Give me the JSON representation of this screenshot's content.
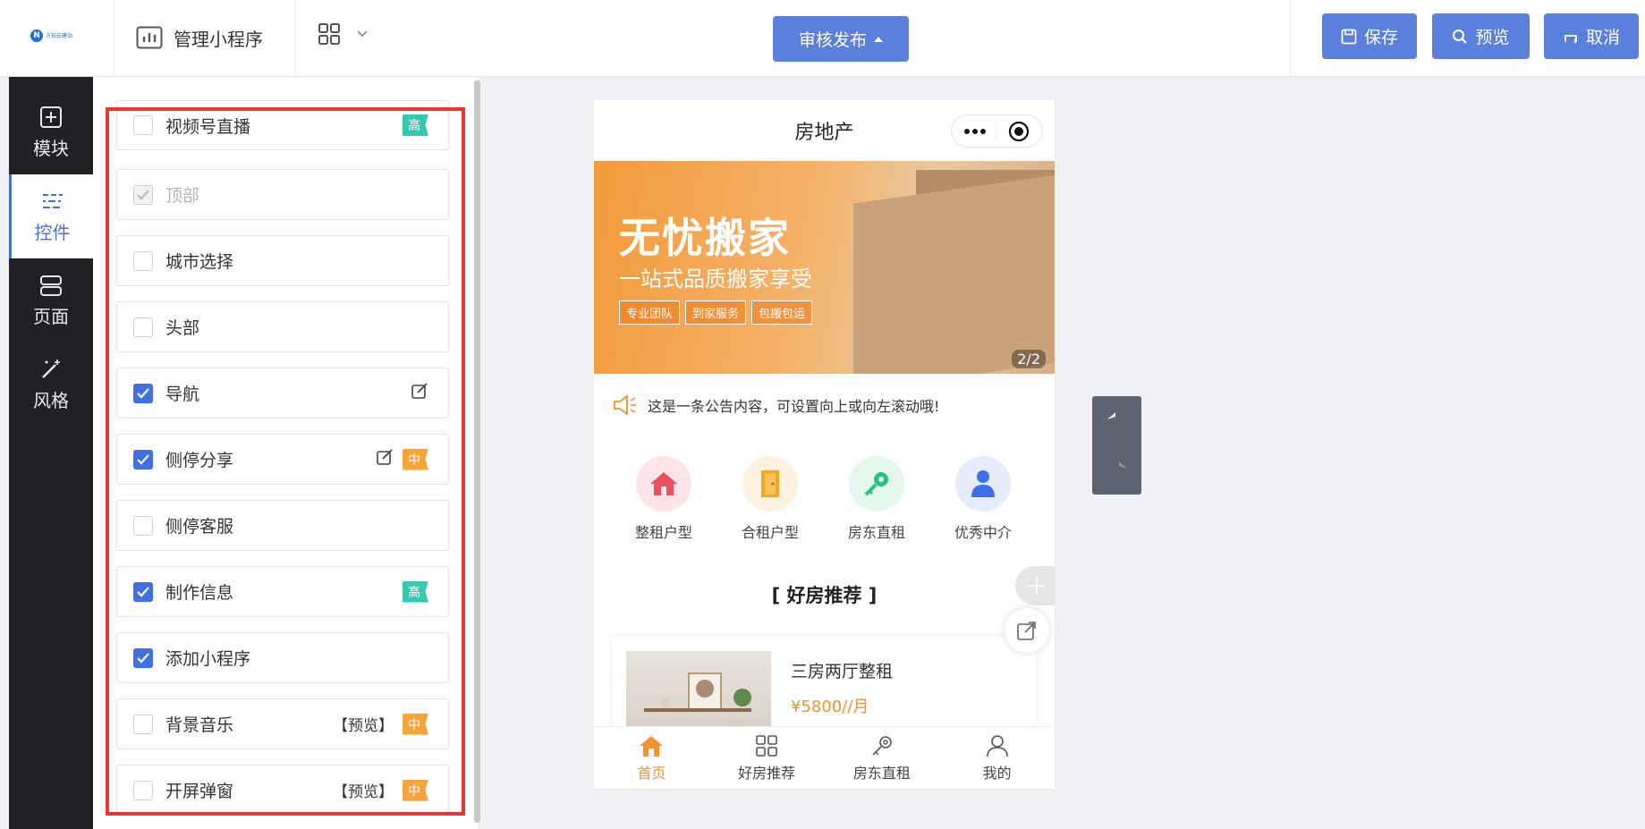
{
  "header": {
    "logo_text": "方知云建站",
    "manage_label": "管理小程序",
    "publish_label": "审核发布",
    "save_label": "保存",
    "preview_label": "预览",
    "cancel_label": "取消"
  },
  "leftnav": {
    "items": [
      {
        "label": "模块",
        "icon": "plus-square-icon"
      },
      {
        "label": "控件",
        "icon": "sliders-icon",
        "active": true
      },
      {
        "label": "页面",
        "icon": "page-icon"
      },
      {
        "label": "风格",
        "icon": "magic-wand-icon"
      }
    ]
  },
  "controls": [
    {
      "label": "视频号直播",
      "checked": false,
      "badge": "高",
      "badge_type": "high"
    },
    {
      "label": "顶部",
      "checked": true,
      "disabled": true
    },
    {
      "label": "城市选择",
      "checked": false
    },
    {
      "label": "头部",
      "checked": false
    },
    {
      "label": "导航",
      "checked": true,
      "editable": true
    },
    {
      "label": "侧停分享",
      "checked": true,
      "editable": true,
      "badge": "中",
      "badge_type": "mid"
    },
    {
      "label": "侧停客服",
      "checked": false
    },
    {
      "label": "制作信息",
      "checked": true,
      "badge": "高",
      "badge_type": "high"
    },
    {
      "label": "添加小程序",
      "checked": true
    },
    {
      "label": "背景音乐",
      "checked": false,
      "preview": "【预览】",
      "badge": "中",
      "badge_type": "mid"
    },
    {
      "label": "开屏弹窗",
      "checked": false,
      "preview": "【预览】",
      "badge": "中",
      "badge_type": "mid"
    }
  ],
  "phone": {
    "title": "房地产",
    "banner": {
      "title": "无忧搬家",
      "subtitle": "一站式品质搬家享受",
      "tags": [
        "专业团队",
        "到家服务",
        "包搬包运"
      ],
      "pager": "2/2"
    },
    "notice": "这是一条公告内容，可设置向上或向左滚动哦!",
    "categories": [
      {
        "label": "整租户型",
        "color": "#fde4e8",
        "icon": "house-icon"
      },
      {
        "label": "合租户型",
        "color": "#fdf1df",
        "icon": "door-icon"
      },
      {
        "label": "房东直租",
        "color": "#e3f7ec",
        "icon": "key-icon"
      },
      {
        "label": "优秀中介",
        "color": "#e4ebfb",
        "icon": "agent-icon"
      }
    ],
    "section_title": "[ 好房推荐 ]",
    "card": {
      "name": "三房两厅整租",
      "price": "¥5800//月"
    },
    "tabs": [
      {
        "label": "首页",
        "active": true
      },
      {
        "label": "好房推荐"
      },
      {
        "label": "房东直租"
      },
      {
        "label": "我的"
      }
    ]
  },
  "colors": {
    "accent": "#5a7fdd",
    "orange": "#f0922f",
    "nav_bg": "#1f2127"
  }
}
